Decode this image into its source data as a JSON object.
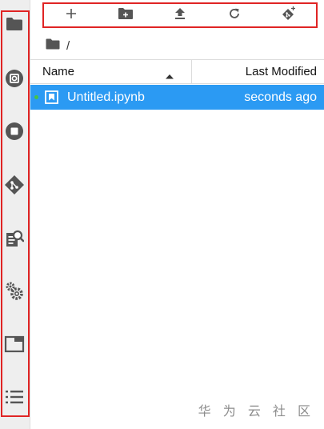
{
  "sidebar": {
    "tabs": [
      {
        "id": "file-browser",
        "icon": "folder-icon",
        "active": true
      },
      {
        "id": "running",
        "icon": "running-icon"
      },
      {
        "id": "commands",
        "icon": "stop-circle-icon"
      },
      {
        "id": "git",
        "icon": "git-icon"
      },
      {
        "id": "property-inspector",
        "icon": "document-search-icon"
      },
      {
        "id": "settings",
        "icon": "gears-icon"
      },
      {
        "id": "tabs",
        "icon": "tab-window-icon"
      },
      {
        "id": "toc",
        "icon": "list-icon"
      }
    ]
  },
  "toolbar": {
    "items": [
      {
        "icon": "plus-icon"
      },
      {
        "icon": "new-folder-icon"
      },
      {
        "icon": "upload-icon"
      },
      {
        "icon": "refresh-icon"
      },
      {
        "icon": "git-clone-icon"
      }
    ]
  },
  "breadcrumb": {
    "root_icon": "folder-icon",
    "path": "/"
  },
  "file_list": {
    "columns": {
      "name": "Name",
      "modified": "Last Modified"
    },
    "sort_icon": "caret-up-icon",
    "rows": [
      {
        "name": "Untitled.ipynb",
        "modified": "seconds ago",
        "icon": "notebook-icon",
        "selected": true,
        "running": true
      }
    ]
  },
  "watermark": "华 为 云 社 区",
  "colors": {
    "selection": "#2b9af3",
    "highlight_box": "#e02424",
    "icon": "#555555",
    "running_dot": "#45c446"
  }
}
